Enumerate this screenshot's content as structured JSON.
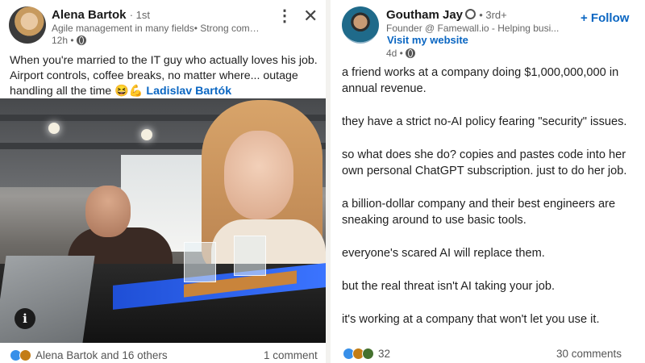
{
  "left_post": {
    "author": "Alena Bartok",
    "degree": "· 1st",
    "headline": "Agile management in many fields• Strong commu...",
    "time": "12h •",
    "body": "When you're married to the IT guy who actually loves his job. Airport controls, coffee breaks, no matter where... outage handling all the time 😆💪",
    "mention": "Ladislav Bartók",
    "menu_icon": "⋮",
    "close_icon": "✕",
    "info_icon": "i",
    "reactions_text": "Alena Bartok and 16 others",
    "comments_text": "1 comment"
  },
  "right_post": {
    "author": "Goutham Jay",
    "degree": "• 3rd+",
    "headline": "Founder @ Famewall.io - Helping busi...",
    "website_link": "Visit my website",
    "time": "4d •",
    "follow_label": "+ Follow",
    "paragraphs": [
      "a friend works at a company doing $1,000,000,000 in annual revenue.",
      "they have a strict no-AI policy fearing \"security\" issues.",
      "so what does she do? copies and pastes code into her own personal ChatGPT subscription. just to do her job.",
      "a billion-dollar company and their best engineers are sneaking around to use basic tools.",
      "everyone's scared AI will replace them.",
      "but the real threat isn't AI taking your job.",
      "it's working at a company that won't let you use it."
    ],
    "reactions_count": "32",
    "comments_text": "30 comments"
  },
  "colors": {
    "link_blue": "#0a66c2",
    "muted_text": "#666666"
  }
}
